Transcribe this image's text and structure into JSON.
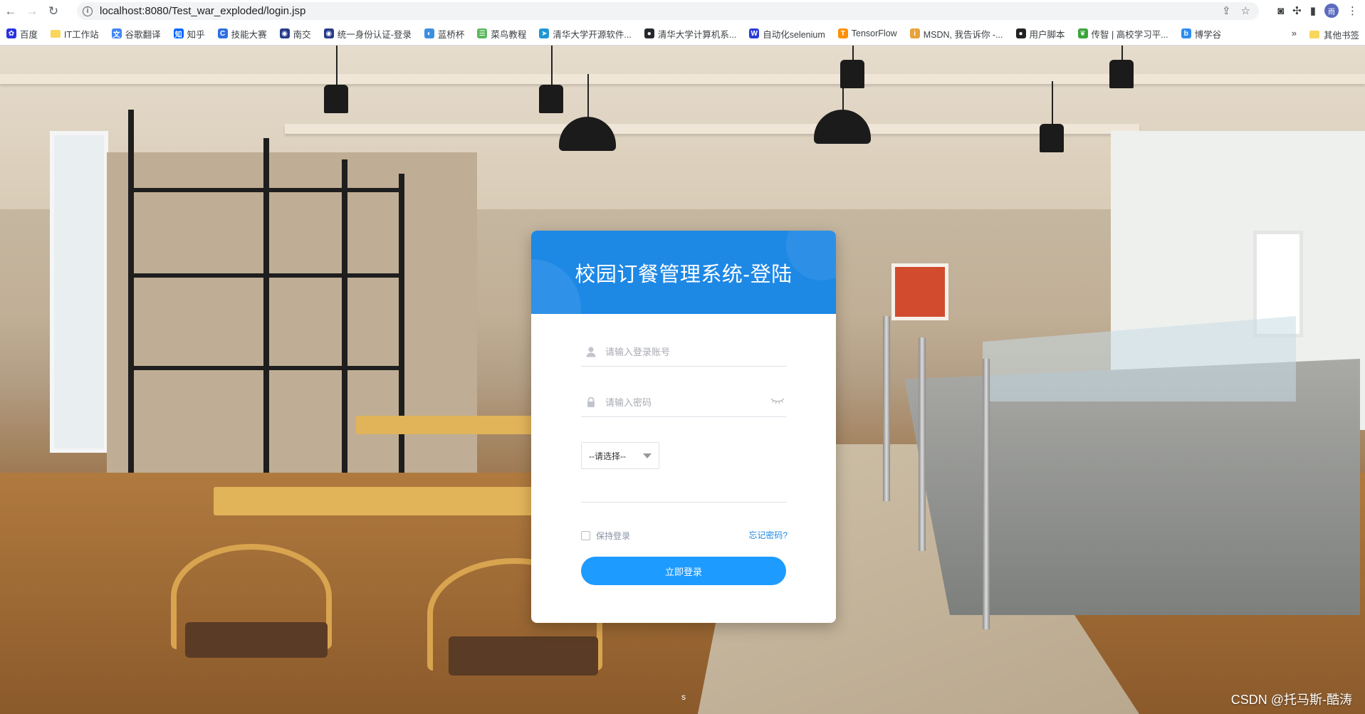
{
  "browser": {
    "url": "localhost:8080/Test_war_exploded/login.jsp",
    "avatar_initial": "雨"
  },
  "bookmarks": [
    {
      "label": "百度",
      "icon": "paw-icon",
      "color": "#2932e1",
      "glyph": "✿"
    },
    {
      "label": "IT工作站",
      "icon": "folder-icon",
      "color": "#f9d65c",
      "glyph": ""
    },
    {
      "label": "谷歌翻译",
      "icon": "translate-icon",
      "color": "#4285f4",
      "glyph": "文"
    },
    {
      "label": "知乎",
      "icon": "zhihu-icon",
      "color": "#0066ff",
      "glyph": "知"
    },
    {
      "label": "技能大赛",
      "icon": "skill-icon",
      "color": "#2f6fe0",
      "glyph": "C"
    },
    {
      "label": "南交",
      "icon": "university-icon",
      "color": "#253b8a",
      "glyph": "◉"
    },
    {
      "label": "统一身份认证-登录",
      "icon": "auth-icon",
      "color": "#253b8a",
      "glyph": "◉"
    },
    {
      "label": "蓝桥杯",
      "icon": "lanqiao-icon",
      "color": "#3d8fe0",
      "glyph": "◐"
    },
    {
      "label": "菜鸟教程",
      "icon": "runoob-icon",
      "color": "#5bb75b",
      "glyph": "☰"
    },
    {
      "label": "清华大学开源软件...",
      "icon": "tuna-icon",
      "color": "#1f97d4",
      "glyph": "➤"
    },
    {
      "label": "清华大学计算机系...",
      "icon": "github-icon",
      "color": "#24292e",
      "glyph": "●"
    },
    {
      "label": "自动化selenium",
      "icon": "w-icon",
      "color": "#2a3bd6",
      "glyph": "W"
    },
    {
      "label": "TensorFlow",
      "icon": "tensorflow-icon",
      "color": "#ff8f00",
      "glyph": "T"
    },
    {
      "label": "MSDN, 我告诉你 -...",
      "icon": "msdn-icon",
      "color": "#e8a33b",
      "glyph": "i"
    },
    {
      "label": "用户脚本",
      "icon": "script-icon",
      "color": "#222222",
      "glyph": "●"
    },
    {
      "label": "传智 | 高校学习平...",
      "icon": "chuanzhi-icon",
      "color": "#3aa53a",
      "glyph": "❦"
    },
    {
      "label": "博学谷",
      "icon": "boxuegu-icon",
      "color": "#2d8cf0",
      "glyph": "b"
    }
  ],
  "bookmarks_more": "»",
  "other_bookmarks": "其他书签",
  "login": {
    "title": "校园订餐管理系统-登陆",
    "account_placeholder": "请输入登录账号",
    "password_placeholder": "请输入密码",
    "role_select_value": "--请选择--",
    "remember_label": "保持登录",
    "forgot_label": "忘记密码?",
    "submit_label": "立即登录"
  },
  "page_mark": "s",
  "watermark": "CSDN @托马斯-酷涛",
  "colors": {
    "header_blue": "#1e88e5",
    "button_blue": "#1e9bff",
    "link_blue": "#1e88e5"
  }
}
